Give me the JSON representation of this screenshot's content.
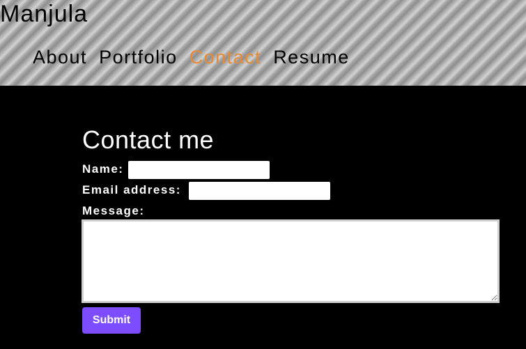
{
  "header": {
    "site_title": "Manjula",
    "nav": [
      {
        "label": "About",
        "active": false
      },
      {
        "label": "Portfolio",
        "active": false
      },
      {
        "label": "Contact",
        "active": true
      },
      {
        "label": "Resume",
        "active": false
      }
    ],
    "active_color": "#e58c3c"
  },
  "contact": {
    "heading": "Contact me",
    "name_label": "Name:",
    "name_value": "",
    "email_label": "Email address:",
    "email_value": "",
    "message_label": "Message:",
    "message_value": "",
    "submit_label": "Submit",
    "submit_color": "#7c4dff"
  }
}
